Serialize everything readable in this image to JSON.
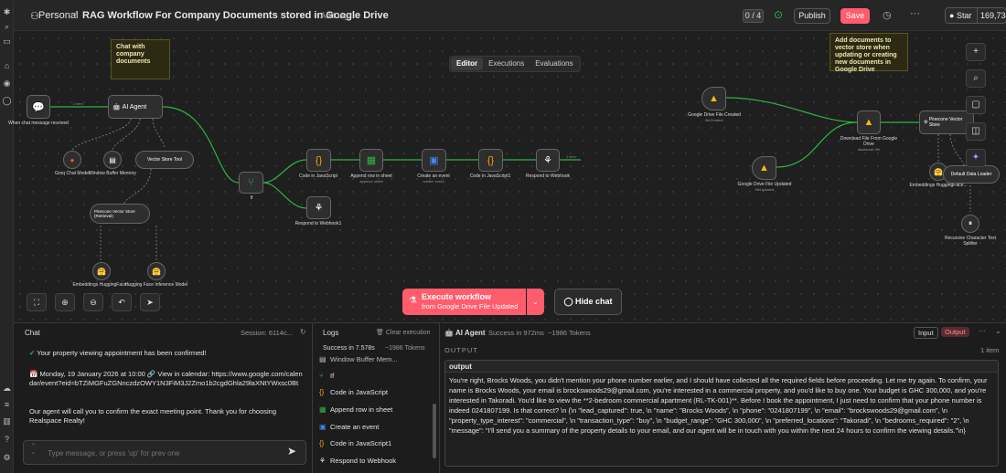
{
  "header": {
    "workspace": "Personal",
    "workflow_name": "RAG Workflow For Company Documents stored in Google Drive",
    "add_tag": "+ Add tag",
    "counter": "0 / 4",
    "publish_label": "Publish",
    "save_label": "Save",
    "star_label": "Star",
    "star_count": "169,734"
  },
  "canvas": {
    "tabs": [
      {
        "label": "Editor",
        "active": true
      },
      {
        "label": "Executions",
        "active": false
      },
      {
        "label": "Evaluations",
        "active": false
      }
    ],
    "sticky_notes": [
      "Chat with company documents",
      "Add documents to vector store when updating or creating new documents in Google Drive"
    ],
    "nodes": {
      "chat_trigger": "When chat message received",
      "ai_agent": "AI Agent",
      "groq": "Groq Chat Model",
      "window_memory": "Window Buffer Memory",
      "vector_tool": "Vector Store Tool",
      "pinecone_retrieval": "Pinecone Vector Store (Retrieval)",
      "embeddings_hf": "Embeddings HuggingFace...",
      "hf_model": "Hugging Face Inference Model",
      "if_node": "If",
      "code1": "Code in JavaScript",
      "append_sheet": "Append row in sheet",
      "append_sheet_sub": "append: sheet",
      "create_event": "Create an event",
      "create_event_sub": "create: event",
      "code2": "Code in JavaScript1",
      "respond": "Respond to Webhook",
      "respond1": "Respond to Webhook1",
      "gdrive_created": "Google Drive File Created",
      "gdrive_created_sub": "fileCreated",
      "gdrive_updated": "Google Drive File Updated",
      "gdrive_updated_sub": "fileUpdated",
      "download": "Download File From Google Drive",
      "download_sub": "download: file",
      "pinecone_insert": "Pinecone Vector Store",
      "embeddings_hf2": "Embeddings HuggingFace...",
      "default_loader": "Default Data Loader",
      "text_splitter": "Recursive Character Text Splitter"
    },
    "port_labels": {
      "chat_model": "Chat Model",
      "memory": "Memory",
      "tool": "Tool",
      "vector_store": "Vector Store",
      "embedding": "Embedding",
      "model": "Model",
      "document": "Document",
      "text_splitter": "Text Splitter"
    },
    "edge_label": "1 item",
    "execute": {
      "title": "Execute workflow",
      "subtitle": "from Google Drive File Updated"
    },
    "hide_chat": "Hide chat"
  },
  "chat_panel": {
    "title": "Chat",
    "session": "Session: 6114c...",
    "messages": [
      "Your property viewing appointment has been confirmed!",
      "Monday, 19 January 2026 at 10:00",
      "View in calendar:",
      "https://www.google.com/calendar/event?eid=bTZiMGFuZGNnczdzOWY1N3FiM3J2Zmo1b2cgdGhla29laXNtYWxsc0Bt",
      "Our agent will call you to confirm the exact meeting point. Thank you for choosing Realspace Realty!"
    ],
    "input_placeholder": "Type message, or press 'up' for prev one"
  },
  "logs_panel": {
    "title": "Logs",
    "clear": "Clear execution",
    "summary_status": "Success in 7.578s",
    "summary_tokens": "~1986 Tokens",
    "items": [
      {
        "label": "Window Buffer Mem...",
        "icon": "memory-icon"
      },
      {
        "label": "If",
        "icon": "if-icon"
      },
      {
        "label": "Code in JavaScript",
        "icon": "code-icon"
      },
      {
        "label": "Append row in sheet",
        "icon": "sheet-icon"
      },
      {
        "label": "Create an event",
        "icon": "calendar-icon"
      },
      {
        "label": "Code in JavaScript1",
        "icon": "code-icon"
      },
      {
        "label": "Respond to Webhook",
        "icon": "webhook-icon"
      }
    ]
  },
  "output_panel": {
    "node_name": "AI Agent",
    "status": "Success in 972ms",
    "tokens": "~1986 Tokens",
    "input_tab": "Input",
    "output_tab": "Output",
    "section": "OUTPUT",
    "count": "1 item",
    "field": "output",
    "text": "You're right, Brocks Woods, you didn't mention your phone number earlier, and I should have collected all the required fields before proceeding. Let me try again. To confirm, your name is Brocks Woods, your email is brockswoods29@gmail.com, you're interested in a commercial property, and you'd like to buy one. Your budget is GHC 300,000, and you're interested in Takoradi. You'd like to view the **2-bedroom commercial apartment (RL-TK-001)**. Before I book the appointment, I just need to confirm that your phone number is indeed 0241807199. Is that correct? \\n {\\n \"lead_captured\": true, \\n \"name\": \"Brocks Woods\", \\n \"phone\": \"0241807199\", \\n \"email\": \"brockswoods29@gmail.com\", \\n \"property_type_interest\": \"commercial\", \\n \"transaction_type\": \"buy\", \\n \"budget_range\": \"GHC 300,000\", \\n \"preferred_locations\": \"Takoradi\", \\n \"bedrooms_required\": \"2\", \\n \"message\": \"I'll send you a summary of the property details to your email, and our agent will be in touch with you within the next 24 hours to confirm the viewing details.\"\\n}"
  },
  "colors": {
    "accent": "#ff5c6c",
    "success": "#2fb344",
    "sticky": "#2d2a14"
  }
}
